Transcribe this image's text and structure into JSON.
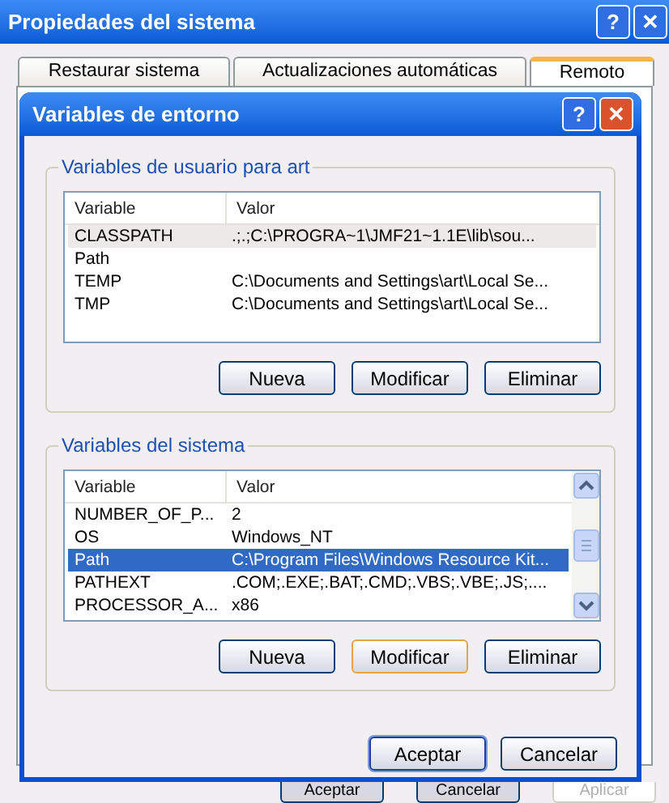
{
  "window": {
    "title": "Propiedades del sistema",
    "help": "?",
    "close": "✕"
  },
  "tabs": [
    {
      "label": "Restaurar sistema",
      "selected": false
    },
    {
      "label": "Actualizaciones automáticas",
      "selected": false
    },
    {
      "label": "Remoto",
      "selected": true
    }
  ],
  "dialog": {
    "title": "Variables de entorno",
    "help": "?",
    "close": "✕",
    "groups": [
      {
        "label": "Variables de usuario para art",
        "focused": false,
        "scrollbar": false,
        "columns": [
          "Variable",
          "Valor"
        ],
        "rows": [
          {
            "cells": [
              "CLASSPATH",
              ".;.;C:\\PROGRA~1\\JMF21~1.1E\\lib\\sou..."
            ],
            "selected": true
          },
          {
            "cells": [
              "Path",
              ""
            ],
            "selected": false
          },
          {
            "cells": [
              "TEMP",
              "C:\\Documents and Settings\\art\\Local Se..."
            ],
            "selected": false
          },
          {
            "cells": [
              "TMP",
              "C:\\Documents and Settings\\art\\Local Se..."
            ],
            "selected": false
          }
        ],
        "buttons": [
          {
            "label": "Nueva",
            "kind": "normal"
          },
          {
            "label": "Modificar",
            "kind": "normal"
          },
          {
            "label": "Eliminar",
            "kind": "normal"
          }
        ]
      },
      {
        "label": "Variables del sistema",
        "focused": true,
        "scrollbar": true,
        "columns": [
          "Variable",
          "Valor"
        ],
        "rows": [
          {
            "cells": [
              "NUMBER_OF_P...",
              "2"
            ],
            "selected": false
          },
          {
            "cells": [
              "OS",
              "Windows_NT"
            ],
            "selected": false
          },
          {
            "cells": [
              "Path",
              "C:\\Program Files\\Windows Resource Kit..."
            ],
            "selected": true
          },
          {
            "cells": [
              "PATHEXT",
              ".COM;.EXE;.BAT;.CMD;.VBS;.VBE;.JS;...."
            ],
            "selected": false
          },
          {
            "cells": [
              "PROCESSOR_A...",
              "x86"
            ],
            "selected": false
          }
        ],
        "buttons": [
          {
            "label": "Nueva",
            "kind": "normal"
          },
          {
            "label": "Modificar",
            "kind": "focused"
          },
          {
            "label": "Eliminar",
            "kind": "normal"
          }
        ]
      }
    ],
    "buttons": [
      {
        "label": "Aceptar",
        "kind": "default"
      },
      {
        "label": "Cancelar",
        "kind": "normal"
      }
    ]
  },
  "buttons": [
    {
      "label": "Aceptar",
      "disabled": false
    },
    {
      "label": "Cancelar",
      "disabled": false
    },
    {
      "label": "Aplicar",
      "disabled": true
    }
  ]
}
